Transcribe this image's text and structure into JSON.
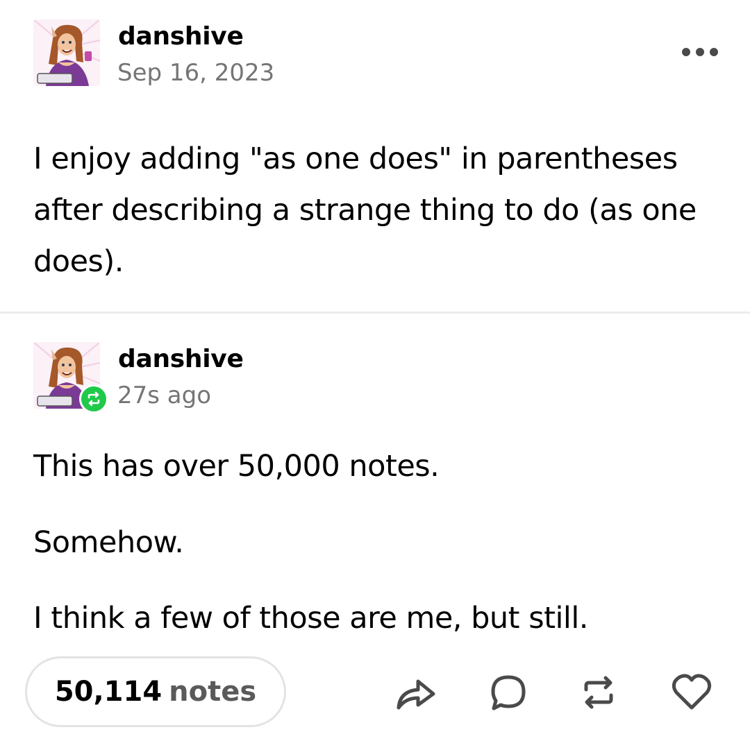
{
  "original_post": {
    "username": "danshive",
    "date": "Sep 16, 2023",
    "text": "I enjoy adding \"as one does\" in parentheses after describing a strange thing to do (as one does)."
  },
  "reblog": {
    "username": "danshive",
    "time": "27s ago",
    "paragraphs": [
      "This has over 50,000 notes.",
      "Somehow.",
      "I think a few of those are me, but still."
    ]
  },
  "footer": {
    "notes_count": "50,114",
    "notes_label": "notes"
  },
  "icons": {
    "more": "more-options-icon",
    "share": "share-icon",
    "reply": "reply-icon",
    "reblog": "reblog-icon",
    "like": "heart-icon",
    "reblog_badge": "reblog-badge-icon"
  },
  "colors": {
    "reblog_badge": "#20c94a",
    "meta_text": "#757575",
    "icon_stroke": "#4a4a4a"
  }
}
